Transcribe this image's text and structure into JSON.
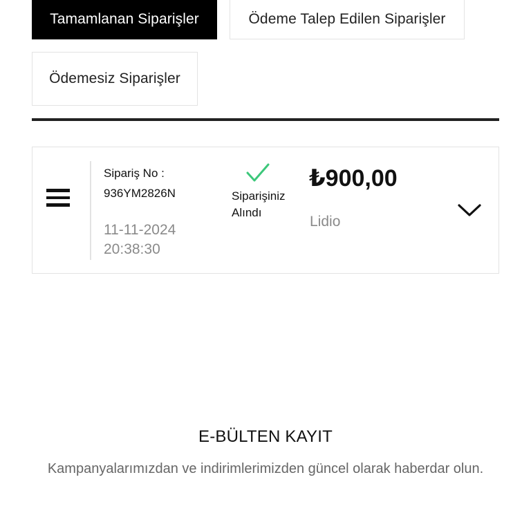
{
  "tabs": {
    "completed": "Tamamlanan Siparişler",
    "payment_requested": "Ödeme Talep Edilen Siparişler",
    "unpaid": "Ödemesiz Siparişler"
  },
  "order": {
    "number_label": "Sipariş No :",
    "number": "936YM2826N",
    "date": "11-11-2024",
    "time": "20:38:30",
    "status": "Siparişiniz Alındı",
    "amount": "₺900,00",
    "provider": "Lidio"
  },
  "newsletter": {
    "title": "E-BÜLTEN KAYIT",
    "description": "Kampanyalarımızdan ve indirimlerimizden güncel olarak haberdar olun."
  },
  "icons": {
    "menu": "hamburger-menu-icon",
    "status": "check-icon",
    "expand": "chevron-down-icon"
  },
  "colors": {
    "active_tab_bg": "#000000",
    "status_check": "#3cc77a",
    "muted_text": "#8a8a8a"
  }
}
